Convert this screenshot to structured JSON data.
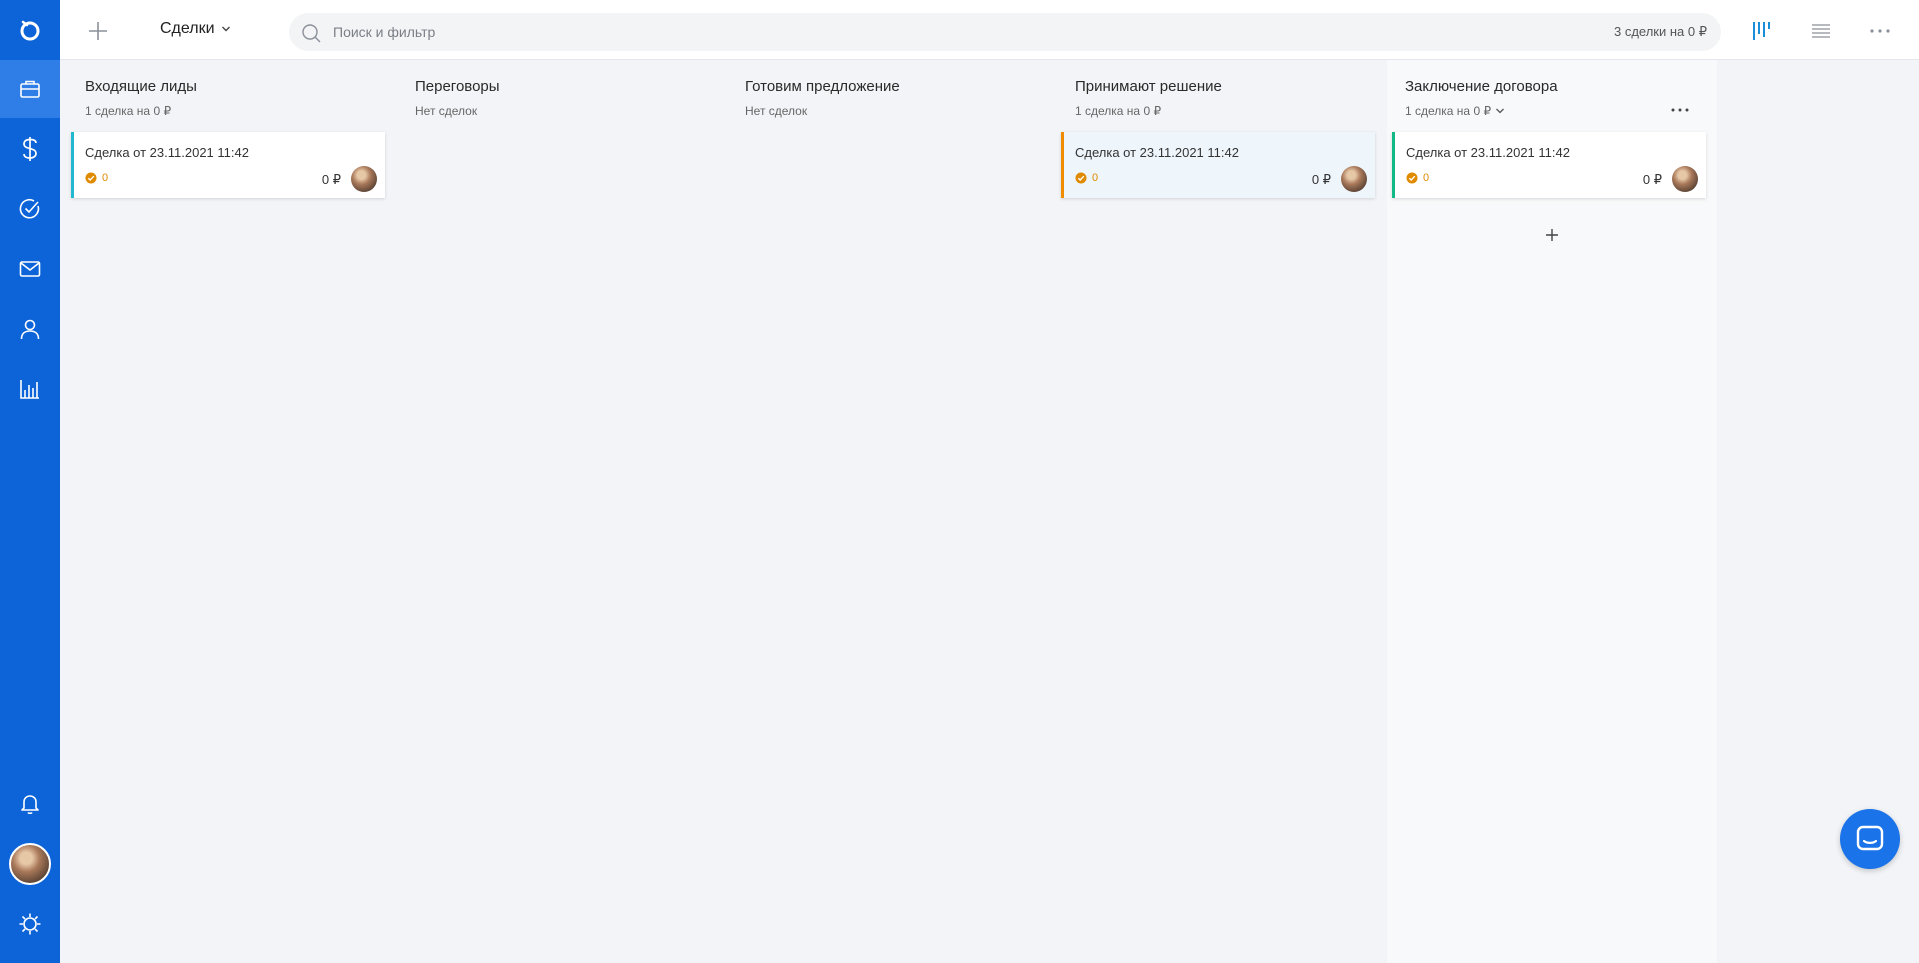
{
  "topbar": {
    "section_label": "Сделки",
    "search_placeholder": "Поиск и фильтр",
    "summary": "3 сделки на 0 ₽"
  },
  "sidebar": {
    "items": [
      {
        "name": "deals",
        "icon": "briefcase-icon",
        "active": true
      },
      {
        "name": "finance",
        "icon": "dollar-icon"
      },
      {
        "name": "tasks",
        "icon": "check-circle-icon"
      },
      {
        "name": "mail",
        "icon": "envelope-icon"
      },
      {
        "name": "contacts",
        "icon": "person-icon"
      },
      {
        "name": "reports",
        "icon": "bar-chart-icon"
      }
    ],
    "bottom": [
      "bell-icon",
      "avatar",
      "gear-icon"
    ]
  },
  "columns": [
    {
      "title": "Входящие лиды",
      "subtitle": "1 сделка на 0 ₽",
      "cards": [
        {
          "title": "Сделка от 23.11.2021 11:42",
          "tasks": "0",
          "amount": "0 ₽",
          "color": "#22b8cf"
        }
      ]
    },
    {
      "title": "Переговоры",
      "subtitle": "Нет сделок",
      "cards": []
    },
    {
      "title": "Готовим предложение",
      "subtitle": "Нет сделок",
      "cards": []
    },
    {
      "title": "Принимают решение",
      "subtitle": "1 сделка на 0 ₽",
      "cards": [
        {
          "title": "Сделка от 23.11.2021 11:42",
          "tasks": "0",
          "amount": "0 ₽",
          "color": "#f08c00"
        }
      ]
    },
    {
      "title": "Заключение договора",
      "subtitle": "1 сделка на 0 ₽",
      "cards": [
        {
          "title": "Сделка от 23.11.2021 11:42",
          "tasks": "0",
          "amount": "0 ₽",
          "color": "#12b886"
        }
      ]
    }
  ],
  "colors": {
    "sidebar": "#0d64d8",
    "accent": "#1a73e8",
    "board_bg": "#f2f4f7"
  }
}
